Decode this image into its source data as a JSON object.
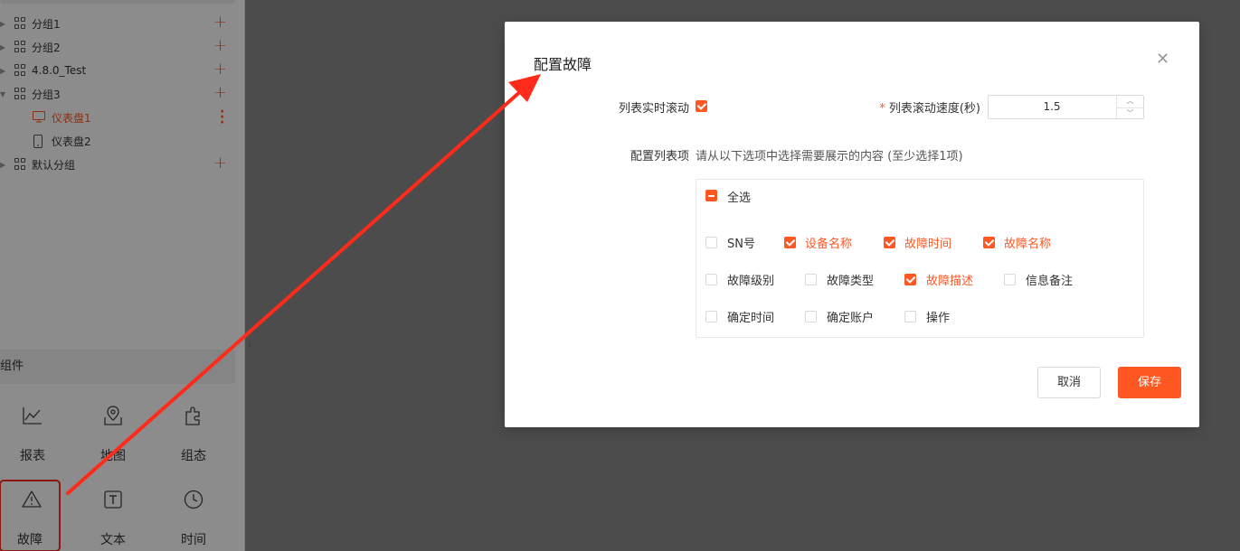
{
  "sidebar": {
    "tree": [
      {
        "label": "分组1",
        "type": "group",
        "expanded": false
      },
      {
        "label": "分组2",
        "type": "group",
        "expanded": false
      },
      {
        "label": "4.8.0_Test",
        "type": "group",
        "expanded": false
      },
      {
        "label": "分组3",
        "type": "group",
        "expanded": true
      },
      {
        "label": "仪表盘1",
        "type": "dashboard-pc",
        "active": true
      },
      {
        "label": "仪表盘2",
        "type": "dashboard-mobile",
        "active": false
      },
      {
        "label": "默认分组",
        "type": "group",
        "expanded": false
      }
    ],
    "components_header": "组件",
    "components": [
      {
        "label": "报表",
        "icon": "line-chart-icon"
      },
      {
        "label": "地图",
        "icon": "map-icon"
      },
      {
        "label": "组态",
        "icon": "puzzle-icon"
      },
      {
        "label": "故障",
        "icon": "warning-icon",
        "highlighted": true
      },
      {
        "label": "文本",
        "icon": "text-icon"
      },
      {
        "label": "时间",
        "icon": "clock-icon"
      }
    ]
  },
  "modal": {
    "title": "配置故障",
    "realtime_scroll_label": "列表实时滚动",
    "realtime_scroll_checked": true,
    "scroll_speed_label": "列表滚动速度(秒)",
    "scroll_speed_value": "1.5",
    "list_items_label": "配置列表项",
    "list_items_hint": "请从以下选项中选择需要展示的内容 (至少选择1项)",
    "select_all_label": "全选",
    "select_all_state": "indeterminate",
    "options": [
      {
        "label": "SN号",
        "checked": false
      },
      {
        "label": "设备名称",
        "checked": true
      },
      {
        "label": "故障时间",
        "checked": true
      },
      {
        "label": "故障名称",
        "checked": true
      },
      {
        "label": "故障级别",
        "checked": false
      },
      {
        "label": "故障类型",
        "checked": false
      },
      {
        "label": "故障描述",
        "checked": true
      },
      {
        "label": "信息备注",
        "checked": false
      },
      {
        "label": "确定时间",
        "checked": false
      },
      {
        "label": "确定账户",
        "checked": false
      },
      {
        "label": "操作",
        "checked": false
      }
    ],
    "cancel_label": "取消",
    "save_label": "保存"
  },
  "colors": {
    "accent": "#ff5722",
    "annotation": "#ff2a1a"
  }
}
